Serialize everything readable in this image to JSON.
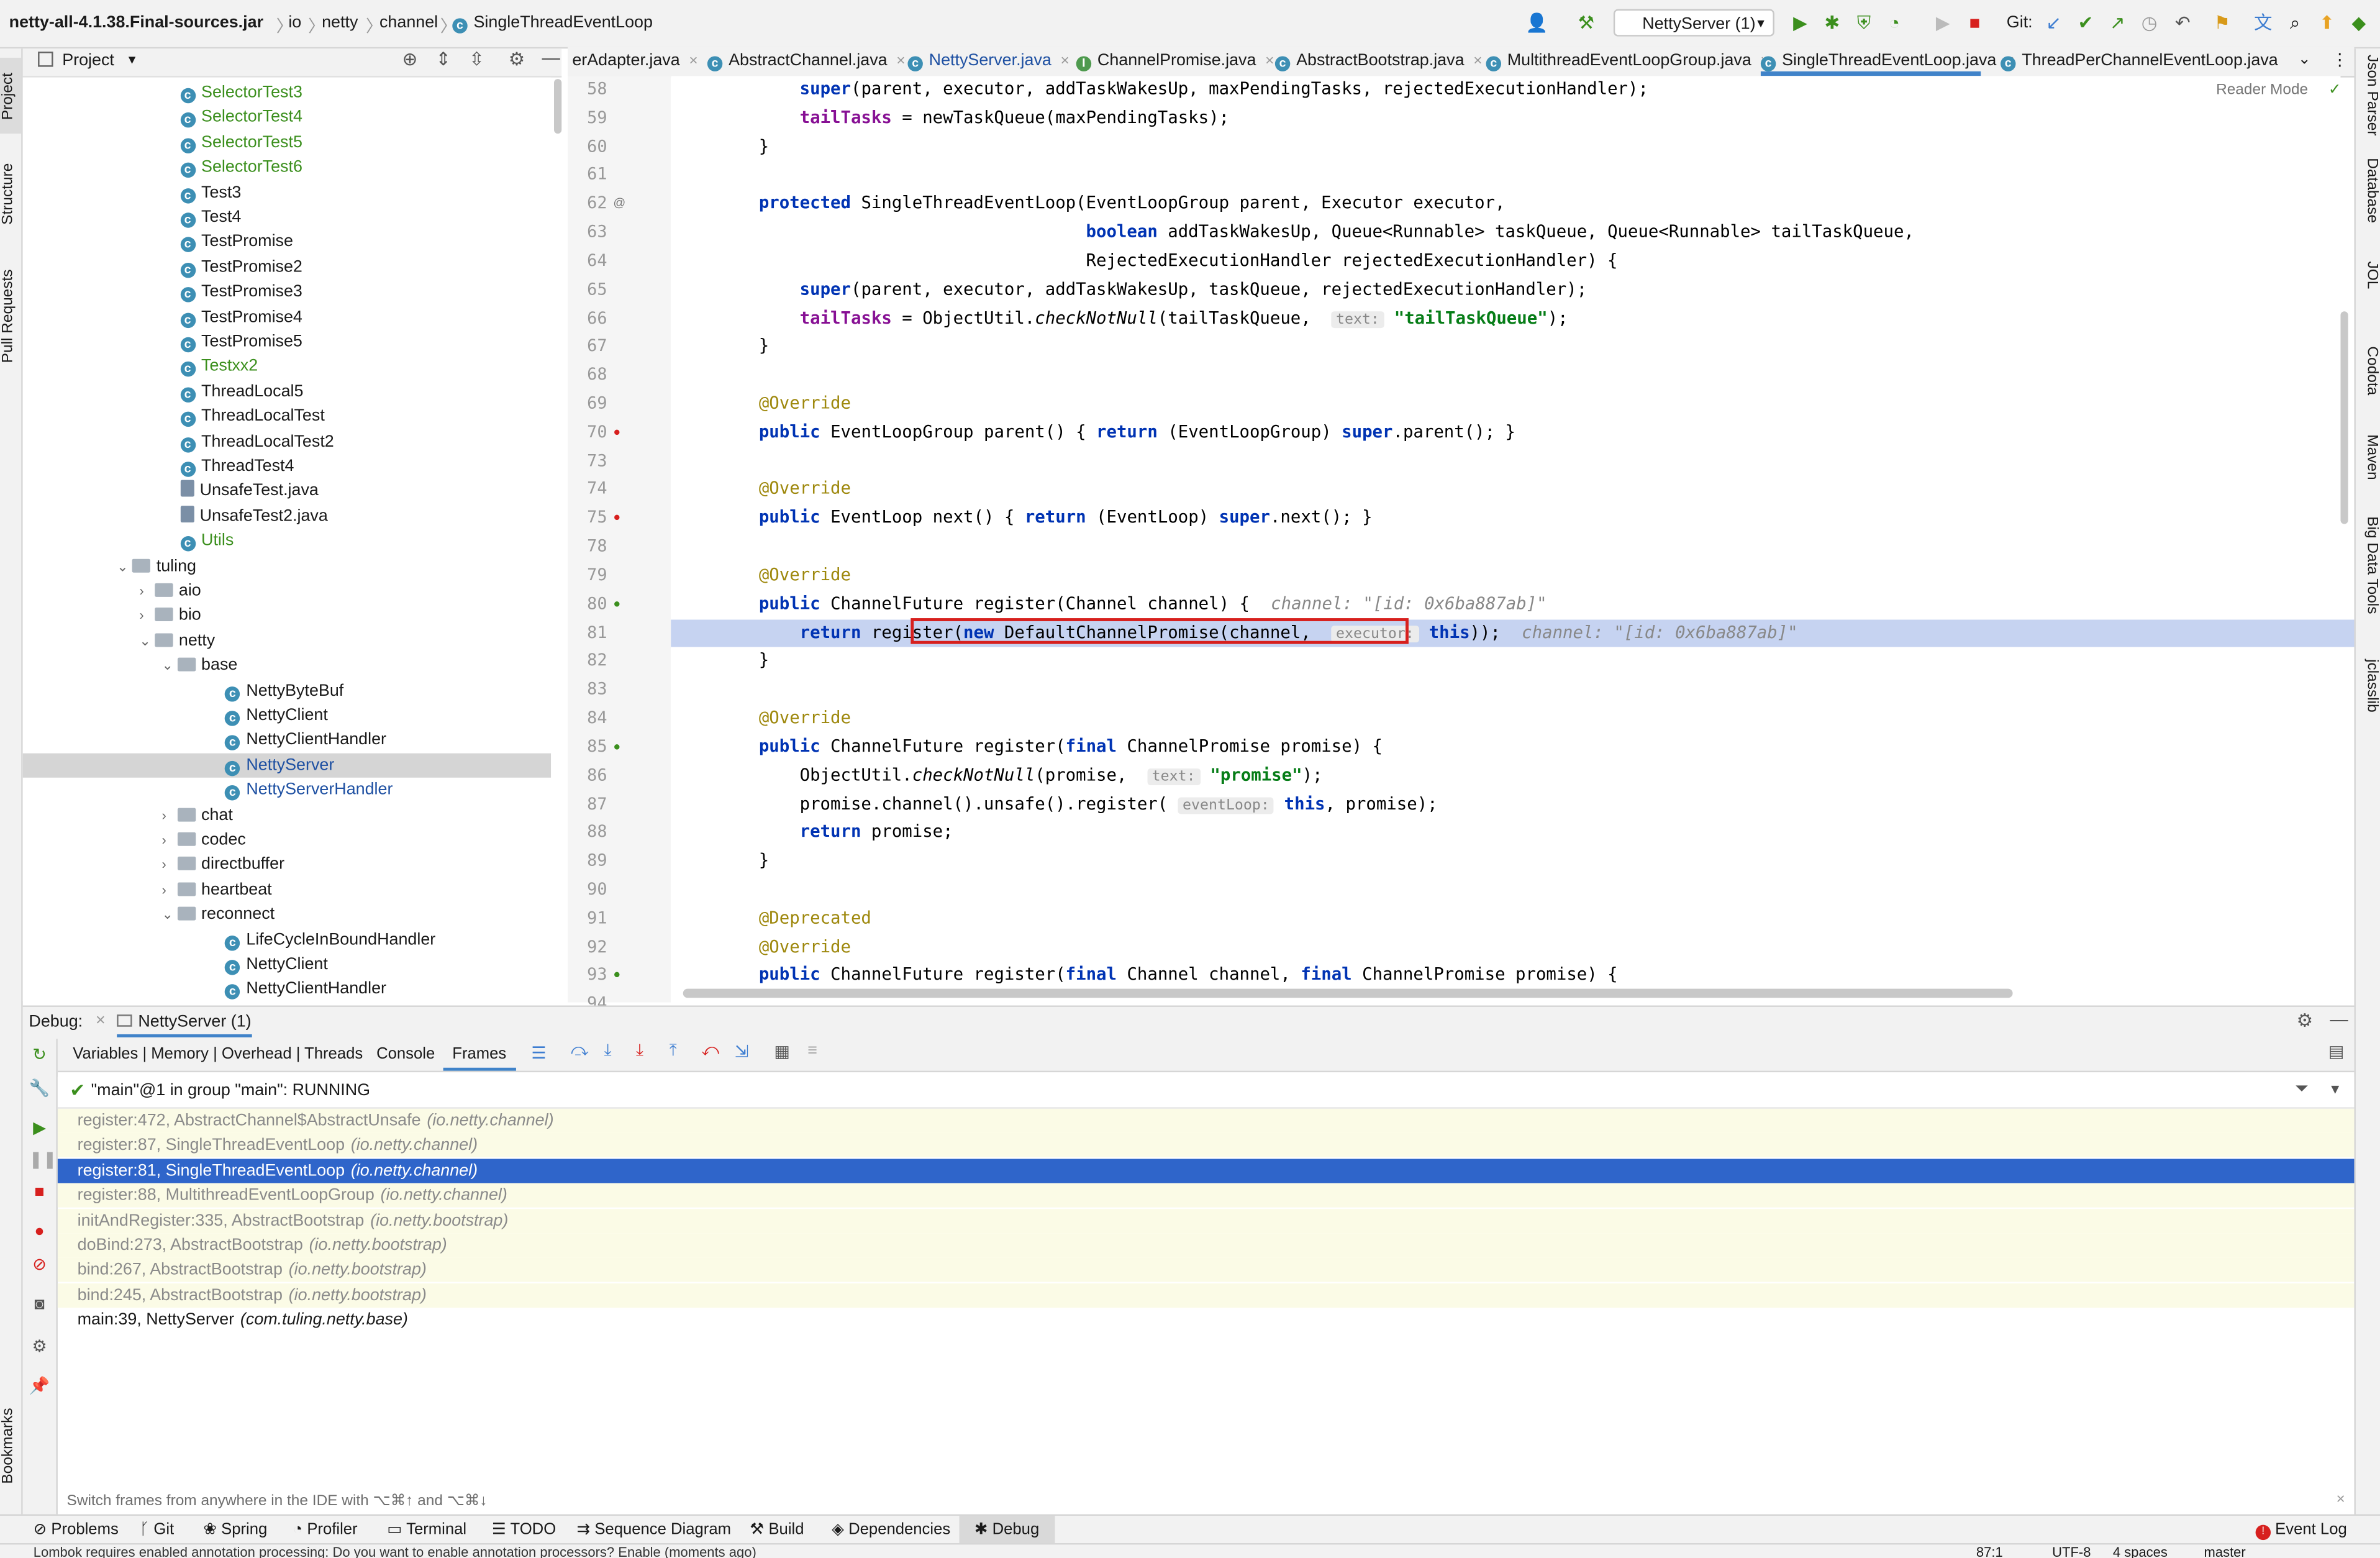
{
  "breadcrumb": [
    "netty-all-4.1.38.Final-sources.jar",
    "io",
    "netty",
    "channel",
    "SingleThreadEventLoop"
  ],
  "toolbar": {
    "run_config": "NettyServer (1)",
    "git_label": "Git:"
  },
  "left_strip": [
    "Project",
    "Structure",
    "Pull Requests",
    "Bookmarks"
  ],
  "right_strip": [
    "Json Parser",
    "Database",
    "JOL",
    "Codota",
    "Maven",
    "Big Data Tools",
    "jclasslib"
  ],
  "project": {
    "title": "Project",
    "rows": [
      {
        "label": "SelectorTest3",
        "kind": "class",
        "color": "green",
        "depth": 7
      },
      {
        "label": "SelectorTest4",
        "kind": "class",
        "color": "green",
        "depth": 7
      },
      {
        "label": "SelectorTest5",
        "kind": "class",
        "color": "green",
        "depth": 7
      },
      {
        "label": "SelectorTest6",
        "kind": "class",
        "color": "green",
        "depth": 7
      },
      {
        "label": "Test3",
        "kind": "class",
        "color": "",
        "depth": 7
      },
      {
        "label": "Test4",
        "kind": "class",
        "color": "",
        "depth": 7
      },
      {
        "label": "TestPromise",
        "kind": "class",
        "color": "",
        "depth": 7
      },
      {
        "label": "TestPromise2",
        "kind": "class",
        "color": "",
        "depth": 7
      },
      {
        "label": "TestPromise3",
        "kind": "class",
        "color": "",
        "depth": 7
      },
      {
        "label": "TestPromise4",
        "kind": "class",
        "color": "",
        "depth": 7
      },
      {
        "label": "TestPromise5",
        "kind": "class",
        "color": "",
        "depth": 7
      },
      {
        "label": "Testxx2",
        "kind": "class",
        "color": "green",
        "depth": 7
      },
      {
        "label": "ThreadLocal5",
        "kind": "class",
        "color": "",
        "depth": 7
      },
      {
        "label": "ThreadLocalTest",
        "kind": "class",
        "color": "",
        "depth": 7
      },
      {
        "label": "ThreadLocalTest2",
        "kind": "class",
        "color": "",
        "depth": 7
      },
      {
        "label": "ThreadTest4",
        "kind": "class",
        "color": "",
        "depth": 7
      },
      {
        "label": "UnsafeTest.java",
        "kind": "file",
        "color": "",
        "depth": 7
      },
      {
        "label": "UnsafeTest2.java",
        "kind": "file",
        "color": "",
        "depth": 7
      },
      {
        "label": "Utils",
        "kind": "class",
        "color": "green",
        "depth": 7
      },
      {
        "label": "tuling",
        "kind": "folder",
        "color": "",
        "depth": 5,
        "arrow": "open"
      },
      {
        "label": "aio",
        "kind": "folder",
        "color": "",
        "depth": 6,
        "arrow": "closed"
      },
      {
        "label": "bio",
        "kind": "folder",
        "color": "",
        "depth": 6,
        "arrow": "closed"
      },
      {
        "label": "netty",
        "kind": "folder",
        "color": "",
        "depth": 6,
        "arrow": "open"
      },
      {
        "label": "base",
        "kind": "folder",
        "color": "",
        "depth": 7,
        "arrow": "open"
      },
      {
        "label": "NettyByteBuf",
        "kind": "class",
        "color": "",
        "depth": 9
      },
      {
        "label": "NettyClient",
        "kind": "class",
        "color": "",
        "depth": 9
      },
      {
        "label": "NettyClientHandler",
        "kind": "class",
        "color": "",
        "depth": 9
      },
      {
        "label": "NettyServer",
        "kind": "class",
        "color": "blue",
        "depth": 9,
        "selected": true
      },
      {
        "label": "NettyServerHandler",
        "kind": "class",
        "color": "blue",
        "depth": 9
      },
      {
        "label": "chat",
        "kind": "folder",
        "color": "",
        "depth": 7,
        "arrow": "closed"
      },
      {
        "label": "codec",
        "kind": "folder",
        "color": "",
        "depth": 7,
        "arrow": "closed"
      },
      {
        "label": "directbuffer",
        "kind": "folder",
        "color": "",
        "depth": 7,
        "arrow": "closed"
      },
      {
        "label": "heartbeat",
        "kind": "folder",
        "color": "",
        "depth": 7,
        "arrow": "closed"
      },
      {
        "label": "reconnect",
        "kind": "folder",
        "color": "",
        "depth": 7,
        "arrow": "open"
      },
      {
        "label": "LifeCycleInBoundHandler",
        "kind": "class",
        "color": "",
        "depth": 9
      },
      {
        "label": "NettyClient",
        "kind": "class",
        "color": "",
        "depth": 9
      },
      {
        "label": "NettyClientHandler",
        "kind": "class",
        "color": "",
        "depth": 9
      }
    ]
  },
  "tabs": [
    {
      "label": "erAdapter.java",
      "active": false
    },
    {
      "label": "AbstractChannel.java",
      "active": false
    },
    {
      "label": "NettyServer.java",
      "active": false,
      "color": "blue"
    },
    {
      "label": "ChannelPromise.java",
      "active": false
    },
    {
      "label": "AbstractBootstrap.java",
      "active": false
    },
    {
      "label": "MultithreadEventLoopGroup.java",
      "active": false
    },
    {
      "label": "SingleThreadEventLoop.java",
      "active": true
    },
    {
      "label": "ThreadPerChannelEventLoop.java",
      "active": false
    }
  ],
  "editor": {
    "reader_mode": "Reader Mode",
    "lines": [
      {
        "n": "58",
        "text": "        super(parent, executor, addTaskWakesUp, maxPendingTasks, rejectedExecutionHandler);"
      },
      {
        "n": "59",
        "text": "        tailTasks = newTaskQueue(maxPendingTasks);"
      },
      {
        "n": "60",
        "text": "    }"
      },
      {
        "n": "61",
        "text": ""
      },
      {
        "n": "62",
        "text": "    protected SingleThreadEventLoop(EventLoopGroup parent, Executor executor,"
      },
      {
        "n": "63",
        "text": "                                    boolean addTaskWakesUp, Queue<Runnable> taskQueue, Queue<Runnable> tailTaskQueue,"
      },
      {
        "n": "64",
        "text": "                                    RejectedExecutionHandler rejectedExecutionHandler) {"
      },
      {
        "n": "65",
        "text": "        super(parent, executor, addTaskWakesUp, taskQueue, rejectedExecutionHandler);"
      },
      {
        "n": "66",
        "text": "        tailTasks = ObjectUtil.checkNotNull(tailTaskQueue,  text: \"tailTaskQueue\");"
      },
      {
        "n": "67",
        "text": "    }"
      },
      {
        "n": "68",
        "text": ""
      },
      {
        "n": "69",
        "text": "    @Override"
      },
      {
        "n": "70",
        "text": "    public EventLoopGroup parent() { return (EventLoopGroup) super.parent(); }"
      },
      {
        "n": "73",
        "text": ""
      },
      {
        "n": "74",
        "text": "    @Override"
      },
      {
        "n": "75",
        "text": "    public EventLoop next() { return (EventLoop) super.next(); }"
      },
      {
        "n": "78",
        "text": ""
      },
      {
        "n": "79",
        "text": "    @Override"
      },
      {
        "n": "80",
        "text": "    public ChannelFuture register(Channel channel) {   channel: \"[id: 0x6ba887ab]\""
      },
      {
        "n": "81",
        "text": "        return register(new DefaultChannelPromise(channel,  executor: this));   channel: \"[id: 0x6ba887ab]\""
      },
      {
        "n": "82",
        "text": "    }"
      },
      {
        "n": "83",
        "text": ""
      },
      {
        "n": "84",
        "text": "    @Override"
      },
      {
        "n": "85",
        "text": "    public ChannelFuture register(final ChannelPromise promise) {"
      },
      {
        "n": "86",
        "text": "        ObjectUtil.checkNotNull(promise,  text: \"promise\");"
      },
      {
        "n": "87",
        "text": "        promise.channel().unsafe().register( eventLoop: this, promise);"
      },
      {
        "n": "88",
        "text": "        return promise;"
      },
      {
        "n": "89",
        "text": "    }"
      },
      {
        "n": "90",
        "text": ""
      },
      {
        "n": "91",
        "text": "    @Deprecated"
      },
      {
        "n": "92",
        "text": "    @Override"
      },
      {
        "n": "93",
        "text": "    public ChannelFuture register(final Channel channel, final ChannelPromise promise) {"
      },
      {
        "n": "94",
        "text": ""
      }
    ]
  },
  "debug": {
    "label": "Debug:",
    "session": "NettyServer (1)",
    "subtabs": [
      "Variables | Memory | Overhead | Threads",
      "Console",
      "Frames"
    ],
    "active_subtab": "Frames",
    "thread": "\"main\"@1 in group \"main\": RUNNING",
    "frames": [
      {
        "text": "register:472, AbstractChannel$AbstractUnsafe",
        "pkg": "(io.netty.channel)",
        "style": "lib"
      },
      {
        "text": "register:87, SingleThreadEventLoop",
        "pkg": "(io.netty.channel)",
        "style": "lib"
      },
      {
        "text": "register:81, SingleThreadEventLoop",
        "pkg": "(io.netty.channel)",
        "style": "sel"
      },
      {
        "text": "register:88, MultithreadEventLoopGroup",
        "pkg": "(io.netty.channel)",
        "style": "lib"
      },
      {
        "text": "initAndRegister:335, AbstractBootstrap",
        "pkg": "(io.netty.bootstrap)",
        "style": "lib"
      },
      {
        "text": "doBind:273, AbstractBootstrap",
        "pkg": "(io.netty.bootstrap)",
        "style": "lib"
      },
      {
        "text": "bind:267, AbstractBootstrap",
        "pkg": "(io.netty.bootstrap)",
        "style": "lib"
      },
      {
        "text": "bind:245, AbstractBootstrap",
        "pkg": "(io.netty.bootstrap)",
        "style": "lib"
      },
      {
        "text": "main:39, NettyServer",
        "pkg": "(com.tuling.netty.base)",
        "style": "user"
      }
    ],
    "switch_hint": "Switch frames from anywhere in the IDE with ⌥⌘↑ and ⌥⌘↓"
  },
  "bottom_tabs": [
    "Problems",
    "Git",
    "Spring",
    "Profiler",
    "Terminal",
    "TODO",
    "Sequence Diagram",
    "Build",
    "Dependencies",
    "Debug"
  ],
  "event_log": "Event Log",
  "status": {
    "message": "Lombok requires enabled annotation processing: Do you want to enable annotation processors? Enable (moments ago)",
    "position": "87:1",
    "encoding": "UTF-8",
    "indent": "4 spaces",
    "branch": "master"
  },
  "colors": {
    "accent": "#4083c9",
    "selection": "#2f65ca",
    "line_highlight": "#c6d3f1",
    "red_box": "#d7201e"
  }
}
